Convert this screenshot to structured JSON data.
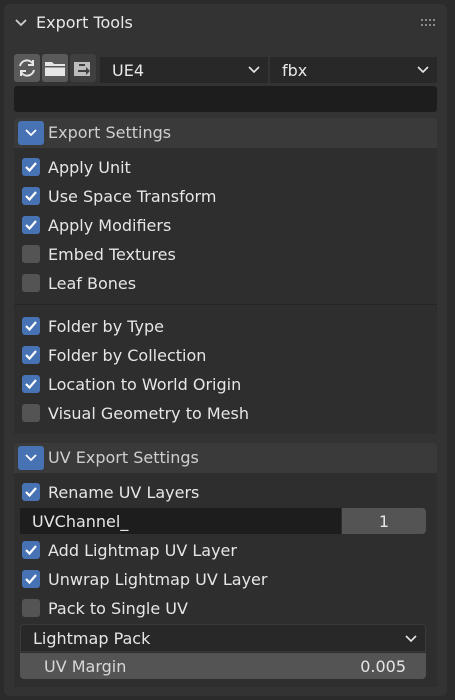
{
  "panel": {
    "title": "Export Tools"
  },
  "toolbar": {
    "engine_value": "UE4",
    "format_value": "fbx"
  },
  "export_settings": {
    "title": "Export Settings",
    "items": [
      {
        "label": "Apply Unit",
        "checked": true
      },
      {
        "label": "Use Space Transform",
        "checked": true
      },
      {
        "label": "Apply Modifiers",
        "checked": true
      },
      {
        "label": "Embed Textures",
        "checked": false
      },
      {
        "label": "Leaf Bones",
        "checked": false
      },
      {
        "label": "Folder by Type",
        "checked": true
      },
      {
        "label": "Folder by Collection",
        "checked": true
      },
      {
        "label": "Location to World Origin",
        "checked": true
      },
      {
        "label": "Visual Geometry to Mesh",
        "checked": false
      }
    ]
  },
  "uv_export_settings": {
    "title": "UV Export Settings",
    "rename_uv": {
      "label": "Rename UV Layers",
      "checked": true
    },
    "uv_name_value": "UVChannel_",
    "uv_index_value": "1",
    "items": [
      {
        "label": "Add Lightmap UV Layer",
        "checked": true
      },
      {
        "label": "Unwrap Lightmap UV Layer",
        "checked": true
      },
      {
        "label": "Pack to Single UV",
        "checked": false
      }
    ],
    "pack_mode_value": "Lightmap Pack",
    "uv_margin_label": "UV Margin",
    "uv_margin_value": "0.005"
  },
  "colors": {
    "accent": "#4772b3",
    "panel_bg": "#333333",
    "field_bg": "#1d1d1d"
  }
}
